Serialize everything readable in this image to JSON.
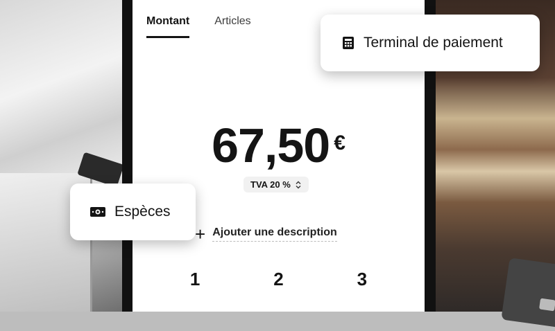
{
  "tabs": [
    {
      "label": "Montant",
      "active": true
    },
    {
      "label": "Articles",
      "active": false
    }
  ],
  "amount": {
    "value": "67,50",
    "currency": "€"
  },
  "vat": {
    "label": "TVA 20 %"
  },
  "add_description": {
    "label": "Ajouter une description"
  },
  "keypad": {
    "keys": [
      "1",
      "2",
      "3"
    ]
  },
  "payment_options": {
    "terminal": {
      "label": "Terminal de paiement",
      "icon": "calculator-icon"
    },
    "cash": {
      "label": "Espèces",
      "icon": "banknote-icon"
    }
  }
}
